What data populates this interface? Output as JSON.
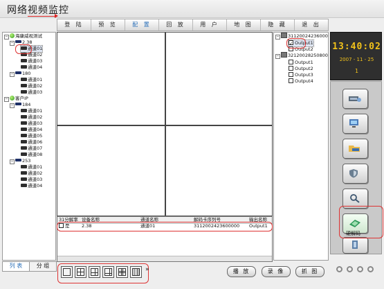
{
  "app": {
    "title": "网络视频监控"
  },
  "menu": [
    {
      "label": "登 陆",
      "active": false
    },
    {
      "label": "预 览",
      "active": false
    },
    {
      "label": "配 置",
      "active": true
    },
    {
      "label": "回 放",
      "active": false
    },
    {
      "label": "用 户",
      "active": false
    },
    {
      "label": "地 图",
      "active": false
    },
    {
      "label": "隐 藏",
      "active": false
    },
    {
      "label": "退 出",
      "active": false
    }
  ],
  "tree": {
    "root": "海康威视测试",
    "group1": {
      "name": "2.38",
      "channels": [
        "通道01",
        "通道02",
        "通道03",
        "通道04"
      ]
    },
    "group2": {
      "name": "180",
      "channels": [
        "通道01",
        "通道02",
        "通道03"
      ]
    },
    "root2": "客户IP",
    "group3": {
      "name": "184",
      "channels": [
        "通道01",
        "通道02",
        "通道03",
        "通道04",
        "通道05",
        "通道06",
        "通道07",
        "通道08"
      ]
    },
    "group4": {
      "name": "253",
      "channels": [
        "通道01",
        "通道02",
        "通道03",
        "通道04"
      ]
    }
  },
  "tabs": {
    "list": "列 表",
    "group": "分 组"
  },
  "table": {
    "headers": [
      "31分解率",
      "设备名称",
      "通道名称",
      "解码卡序列号",
      "输出名称"
    ],
    "rows": [
      {
        "c1": "是",
        "c2": "2.38",
        "c3": "通道01",
        "c4": "3112002423600000",
        "c5": "Output1"
      }
    ]
  },
  "outputs": {
    "card1": "3112002423600000",
    "card1_outputs": [
      {
        "label": "Output1",
        "checked": true
      },
      {
        "label": "Output2",
        "checked": false
      }
    ],
    "card2": "3212002825080000",
    "card2_outputs": [
      {
        "label": "Output1",
        "checked": false
      },
      {
        "label": "Output2",
        "checked": false
      },
      {
        "label": "Output3",
        "checked": false
      },
      {
        "label": "Output4",
        "checked": false
      }
    ]
  },
  "clock": {
    "time": "13:40:02",
    "date": "2007 - 11 - 25",
    "number": "1"
  },
  "side": {
    "decode_label": "硬解码"
  },
  "bottom": {
    "more": "»",
    "play": "播 放",
    "record": "录 像",
    "capture": "抓 图"
  }
}
